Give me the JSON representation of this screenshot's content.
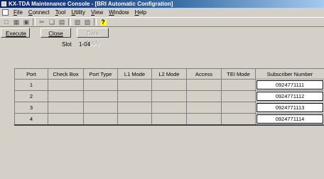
{
  "window": {
    "title": "KX-TDA Maintenance Console - [BRI Automatic Configration]"
  },
  "menu": [
    {
      "first": "F",
      "rest": "ile"
    },
    {
      "first": "C",
      "rest": "onnect"
    },
    {
      "first": "T",
      "rest": "ool"
    },
    {
      "first": "U",
      "rest": "tility"
    },
    {
      "first": "V",
      "rest": "iew"
    },
    {
      "first": "W",
      "rest": "indow"
    },
    {
      "first": "H",
      "rest": "elp"
    }
  ],
  "toolbar": {
    "icons": [
      "new-icon",
      "open-icon",
      "save-icon",
      "cut-icon",
      "copy-icon",
      "paste-icon",
      "print-icon",
      "print-preview-icon",
      "help-icon"
    ],
    "help_glyph": "?"
  },
  "actions": {
    "execute": "Execute",
    "close": "Close",
    "data_apply": "Data Apply"
  },
  "slot": {
    "label": "Slot",
    "value": "1-04"
  },
  "table": {
    "headers": [
      "Port",
      "Check Box",
      "Port Type",
      "L1 Mode",
      "L2 Mode",
      "Access",
      "TEI Mode",
      "Subscriber Number"
    ],
    "rows": [
      {
        "port": "1",
        "subscriber": "0924771111"
      },
      {
        "port": "2",
        "subscriber": "0924771112"
      },
      {
        "port": "3",
        "subscriber": "0924771113"
      },
      {
        "port": "4",
        "subscriber": "0924771114"
      }
    ]
  }
}
